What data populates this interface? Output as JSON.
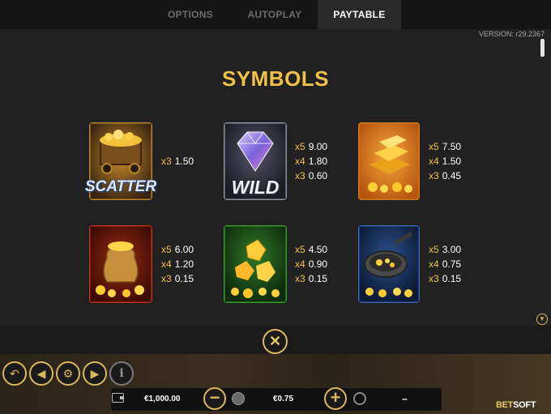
{
  "tabs": [
    {
      "label": "OPTIONS"
    },
    {
      "label": "AUTOPLAY"
    },
    {
      "label": "PAYTABLE",
      "active": true
    }
  ],
  "version": "VERSION: r29.2367",
  "section_title": "SYMBOLS",
  "symbols": [
    {
      "name": "scatter",
      "label": "SCATTER",
      "pays": [
        {
          "k": "x3",
          "v": "1.50"
        }
      ]
    },
    {
      "name": "wild",
      "label": "WILD",
      "pays": [
        {
          "k": "x5",
          "v": "9.00"
        },
        {
          "k": "x4",
          "v": "1.80"
        },
        {
          "k": "x3",
          "v": "0.60"
        }
      ]
    },
    {
      "name": "gold-bars",
      "pays": [
        {
          "k": "x5",
          "v": "7.50"
        },
        {
          "k": "x4",
          "v": "1.50"
        },
        {
          "k": "x3",
          "v": "0.45"
        }
      ]
    },
    {
      "name": "gold-sack",
      "pays": [
        {
          "k": "x5",
          "v": "6.00"
        },
        {
          "k": "x4",
          "v": "1.20"
        },
        {
          "k": "x3",
          "v": "0.15"
        }
      ]
    },
    {
      "name": "gold-nuggets",
      "pays": [
        {
          "k": "x5",
          "v": "4.50"
        },
        {
          "k": "x4",
          "v": "0.90"
        },
        {
          "k": "x3",
          "v": "0.15"
        }
      ]
    },
    {
      "name": "gold-pan",
      "pays": [
        {
          "k": "x5",
          "v": "3.00"
        },
        {
          "k": "x4",
          "v": "0.75"
        },
        {
          "k": "x3",
          "v": "0.15"
        }
      ]
    }
  ],
  "controls": {
    "close": "✕",
    "balance": "€1,000.00",
    "bet": "€0.75",
    "win": "–",
    "minus": "−",
    "plus": "+",
    "info": "i"
  },
  "brand": {
    "a": "BET",
    "b": "SOFT"
  },
  "colors": {
    "accent": "#f0c04a",
    "panel": "#212121",
    "border_gold": "#d9b860"
  }
}
